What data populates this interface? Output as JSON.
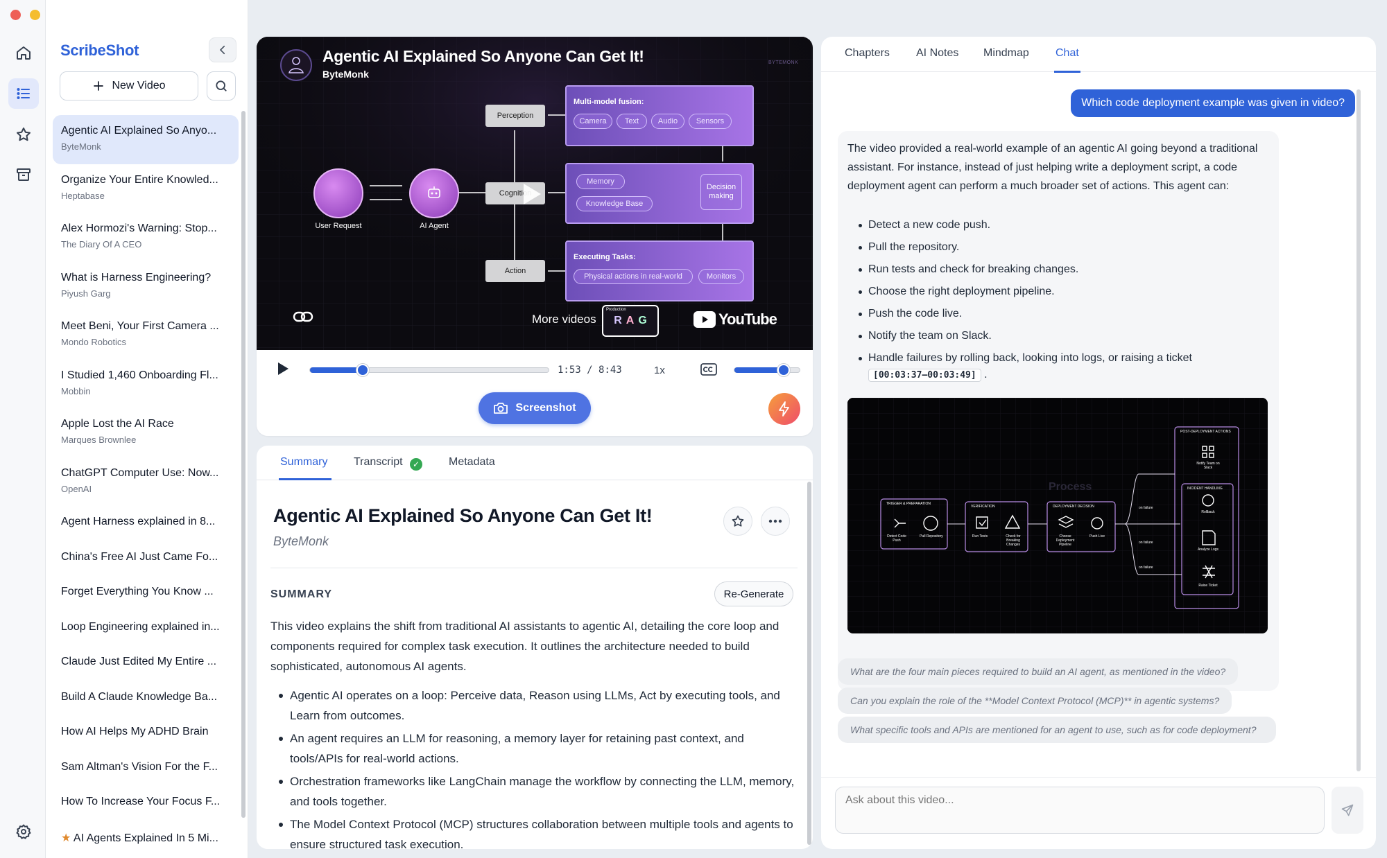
{
  "window": {
    "colors": {
      "close": "#ee5f57",
      "minimize": "#f5bd2f",
      "zoom": "#5fc640"
    }
  },
  "rail": {
    "icons": [
      "home-icon",
      "list-icon",
      "star-icon",
      "archive-icon",
      "gear-icon"
    ]
  },
  "sidebar": {
    "brand": "ScribeShot",
    "new_video_label": "New Video",
    "items": [
      {
        "title": "Agentic AI Explained So Anyo...",
        "channel": "ByteMonk",
        "active": true
      },
      {
        "title": "Organize Your Entire Knowled...",
        "channel": "Heptabase"
      },
      {
        "title": "Alex Hormozi's Warning: Stop...",
        "channel": "The Diary Of A CEO"
      },
      {
        "title": "What is Harness Engineering?",
        "channel": "Piyush Garg"
      },
      {
        "title": "Meet Beni, Your First Camera ...",
        "channel": "Mondo Robotics"
      },
      {
        "title": "I Studied 1,460 Onboarding Fl...",
        "channel": "Mobbin"
      },
      {
        "title": "Apple Lost the AI Race",
        "channel": "Marques Brownlee"
      },
      {
        "title": "ChatGPT Computer Use: Now...",
        "channel": "OpenAI"
      },
      {
        "title": "Agent Harness explained in 8...",
        "channel": ""
      },
      {
        "title": "China's Free AI Just Came Fo...",
        "channel": ""
      },
      {
        "title": "Forget Everything You Know ...",
        "channel": ""
      },
      {
        "title": "Loop Engineering explained in...",
        "channel": ""
      },
      {
        "title": "Claude Just Edited My Entire ...",
        "channel": ""
      },
      {
        "title": "Build A Claude Knowledge Ba...",
        "channel": ""
      },
      {
        "title": "How AI Helps My ADHD Brain",
        "channel": ""
      },
      {
        "title": "Sam Altman's Vision For the F...",
        "channel": ""
      },
      {
        "title": "How To Increase Your Focus F...",
        "channel": ""
      },
      {
        "title": "AI Agents Explained In 5 Mi...",
        "channel": "",
        "starred": true
      }
    ]
  },
  "player": {
    "video_title": "Agentic AI Explained So Anyone Can Get It!",
    "channel": "ByteMonk",
    "logo_text": "BYTEMONK",
    "diagram": {
      "user_request": "User Request",
      "ai_agent": "AI Agent",
      "perception": "Perception",
      "cognition": "Cognition",
      "action": "Action",
      "fusion_title": "Multi-model fusion:",
      "fusion_chips": [
        "Camera",
        "Text",
        "Audio",
        "Sensors"
      ],
      "memory": "Memory",
      "knowledge_base": "Knowledge Base",
      "decision": "Decision making",
      "exec_title": "Executing Tasks:",
      "exec_chips": [
        "Physical actions in real-world",
        "Monitors"
      ]
    },
    "more_videos": "More videos",
    "rag_letters": [
      "R",
      "A",
      "G"
    ],
    "rag_caption": "Production",
    "youtube": "YouTube",
    "current_time": "1:53",
    "duration": "8:43",
    "progress": 0.22,
    "speed": "1x",
    "volume": 0.74,
    "screenshot_label": "Screenshot"
  },
  "summary": {
    "tabs": [
      "Summary",
      "Transcript",
      "Metadata"
    ],
    "active_tab": "Summary",
    "title": "Agentic AI Explained So Anyone Can Get It!",
    "channel": "ByteMonk",
    "section_label": "SUMMARY",
    "regenerate_label": "Re-Generate",
    "paragraph": "This video explains the shift from traditional AI assistants to agentic AI, detailing the core loop and components required for complex task execution. It outlines the architecture needed to build sophisticated, autonomous AI agents.",
    "bullets": [
      "Agentic AI operates on a loop: Perceive data, Reason using LLMs, Act by executing tools, and Learn from outcomes.",
      "An agent requires an LLM for reasoning, a memory layer for retaining past context, and tools/APIs for real-world actions.",
      "Orchestration frameworks like LangChain manage the workflow by connecting the LLM, memory, and tools together.",
      "The Model Context Protocol (MCP) structures collaboration between multiple tools and agents to ensure structured task execution."
    ]
  },
  "chat": {
    "tabs": [
      "Chapters",
      "AI Notes",
      "Mindmap",
      "Chat"
    ],
    "active_tab": "Chat",
    "user_message": "Which code deployment example was given in video?",
    "answer_intro": "The video provided a real-world example of an agentic AI going beyond a traditional assistant. For instance, instead of just helping write a deployment script, a code deployment agent can perform a much broader set of actions. This agent can:",
    "answer_items": [
      "Detect a new code push.",
      "Pull the repository.",
      "Run tests and check for breaking changes.",
      "Choose the right deployment pipeline.",
      "Push the code live.",
      "Notify the team on Slack.",
      "Handle failures by rolling back, looking into logs, or raising a ticket"
    ],
    "timestamp": "[00:03:37–00:03:49]",
    "timestamp_suffix": ".",
    "image_labels": {
      "trigger": "TRIGGER & PREPARATION",
      "verification": "VERIFICATION",
      "deployment": "DEPLOYMENT DECISION",
      "post": "POST-DEPLOYMENT ACTIONS",
      "incident": "INCIDENT HANDLING",
      "detect": "Detect Code Push",
      "pull": "Pull Repository",
      "run": "Run Tests",
      "check": "Check for Breaking Changes",
      "choose": "Choose Deployment Pipeline",
      "push": "Push Live",
      "notify": "Notify Team on Slack",
      "rollback": "Rollback",
      "analyze": "Analyze Logs",
      "raise": "Raise Ticket",
      "on_failure": "on failure",
      "process": "Process"
    },
    "suggestions": [
      "What are the four main pieces required to build an AI agent, as mentioned in the video?",
      "Can you explain the role of the **Model Context Protocol (MCP)** in agentic systems?",
      "What specific tools and APIs are mentioned for an agent to use, such as for code deployment?"
    ],
    "input_placeholder": "Ask about this video..."
  }
}
